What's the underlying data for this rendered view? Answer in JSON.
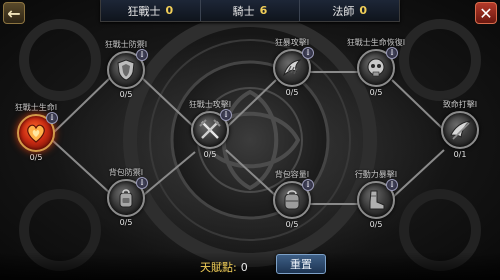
{
  "top_tabs": [
    {
      "label": "狂戰士",
      "count": "0"
    },
    {
      "label": "騎士",
      "count": "6"
    },
    {
      "label": "法師",
      "count": "0"
    }
  ],
  "back_icon": "arrow-left-icon",
  "close_icon": "close-x-icon",
  "skills": [
    {
      "id": "berserker-life",
      "label": "狂戰士生命I",
      "level": "I",
      "progress": "0/5",
      "icon": "flaming-heart-icon",
      "active": true
    },
    {
      "id": "berserker-defense",
      "label": "狂戰士防禦I",
      "level": "I",
      "progress": "0/5",
      "icon": "shield-icon",
      "active": false
    },
    {
      "id": "berserker-attack",
      "label": "狂戰士攻擊I",
      "level": "I",
      "progress": "0/5",
      "icon": "crossed-swords-icon",
      "active": false
    },
    {
      "id": "backstab",
      "label": "背包防禦I",
      "level": "I",
      "progress": "0/5",
      "icon": "backpack-icon",
      "active": false
    },
    {
      "id": "frenzy-attack",
      "label": "狂暴攻擊I",
      "level": "I",
      "progress": "0/5",
      "icon": "beast-claw-icon",
      "active": false
    },
    {
      "id": "backpack-capacity",
      "label": "背包容量I",
      "level": "I",
      "progress": "0/5",
      "icon": "backpack-icon",
      "active": false
    },
    {
      "id": "berserker-regen",
      "label": "狂戰士生命恢復I",
      "level": "I",
      "progress": "0/5",
      "icon": "skull-regen-icon",
      "active": false
    },
    {
      "id": "action-boost",
      "label": "行動力暴擊I",
      "level": "I",
      "progress": "0/5",
      "icon": "boots-icon",
      "active": false
    },
    {
      "id": "fatal-strike",
      "label": "致命打擊I",
      "level": "I",
      "progress": "0/1",
      "icon": "dragon-slash-icon",
      "active": false
    }
  ],
  "bottom": {
    "points_label": "天賦點:",
    "points_value": "0",
    "reset_label": "重置"
  }
}
